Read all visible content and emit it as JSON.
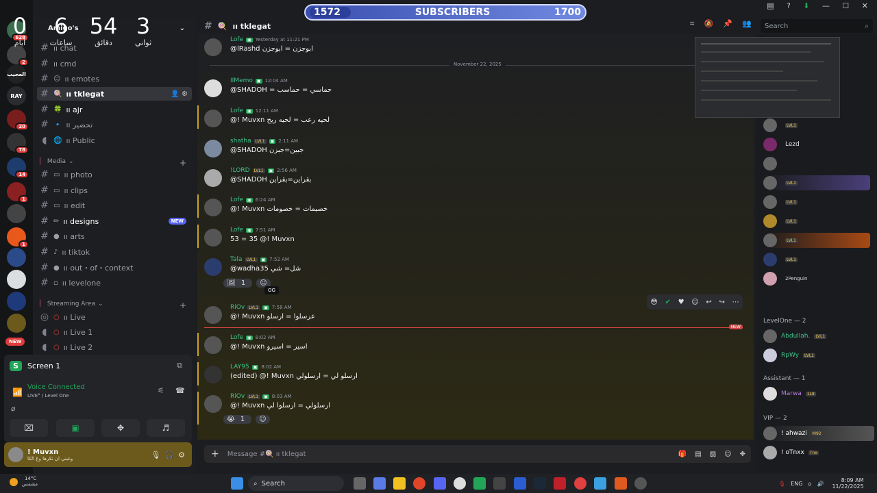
{
  "subscriber_bar": {
    "current": "1572",
    "label": "SUBSCRIBERS",
    "goal": "1700"
  },
  "countdown": [
    {
      "value": "0",
      "label": "أيام"
    },
    {
      "value": "6",
      "label": "ساعات"
    },
    {
      "value": "54",
      "label": "دقائق"
    },
    {
      "value": "3",
      "label": "ثواني"
    }
  ],
  "server": {
    "name": "Amigo's"
  },
  "server_rail": [
    {
      "label": "",
      "badge": "628"
    },
    {
      "label": "",
      "badge": "2"
    },
    {
      "label": "العجيب",
      "badge": ""
    },
    {
      "label": "RAY",
      "badge": ""
    },
    {
      "label": "",
      "badge": "20"
    },
    {
      "label": "",
      "badge": "78"
    },
    {
      "label": "",
      "badge": "14"
    },
    {
      "label": "",
      "badge": "1"
    },
    {
      "label": "",
      "badge": ""
    },
    {
      "label": "",
      "badge": "1"
    },
    {
      "label": "",
      "badge": ""
    },
    {
      "label": "",
      "badge": ""
    },
    {
      "label": "",
      "badge": ""
    },
    {
      "label": "",
      "badge": ""
    }
  ],
  "server_new": "NEW",
  "channels": {
    "top": [
      {
        "name": "ıı chat",
        "emoji": ""
      },
      {
        "name": "ıı cmd",
        "emoji": ""
      },
      {
        "name": "ıı emotes",
        "emoji": ""
      },
      {
        "name": "ıı tklegat",
        "emoji": "🍭",
        "active": true
      },
      {
        "name": "ıı ajr",
        "emoji": "🍀"
      },
      {
        "name": "ıı تحضير",
        "emoji": "🔹"
      },
      {
        "name": "ıı Public",
        "emoji": "🌐",
        "voice": true
      }
    ],
    "media_category": "Media",
    "media": [
      {
        "name": "ıı photo",
        "emoji": "▭"
      },
      {
        "name": "ıı clips",
        "emoji": "▭"
      },
      {
        "name": "ıı edit",
        "emoji": "▭"
      },
      {
        "name": "ıı designs",
        "emoji": "✏",
        "new": "NEW"
      },
      {
        "name": "ıı arts",
        "emoji": "●"
      },
      {
        "name": "ıı tiktok",
        "emoji": "♪"
      },
      {
        "name": "ıı out・of・context",
        "emoji": "●"
      },
      {
        "name": "ıı levelone",
        "emoji": "▫"
      }
    ],
    "streaming_category": "Streaming Area",
    "streaming": [
      {
        "name": "ıı Live"
      },
      {
        "name": "ıı Live 1"
      },
      {
        "name": "ıı Live 2"
      }
    ]
  },
  "screen_share": {
    "label": "Screen 1"
  },
  "voice": {
    "status": "Voice Connected",
    "detail": "LIVE° / Level One"
  },
  "user": {
    "name": "! Muvxn",
    "status": "وغبني ان تكرها وغ الكا"
  },
  "chat": {
    "channel": "ıı tklegat",
    "date_divider": "November 22, 2025",
    "new_label": "NEW",
    "tooltip": "OG",
    "messages": [
      {
        "name": "Lofe",
        "time": "Yesterday at 11:21 PM",
        "body": "@lRashd ابوجزن = ابوجزن",
        "color": "#3ec48a"
      },
      {
        "name": "IIMemo",
        "time": "12:04 AM",
        "body": "@SHADOH = حماسي = حماسب",
        "color": "#3ec48a"
      },
      {
        "name": "Lofe",
        "time": "12:11 AM",
        "body": "@! Muvxn لحيه رعب = لحيه ريح",
        "color": "#3ec48a"
      },
      {
        "name": "shatha",
        "time": "2:11 AM",
        "body": "@SHADOH جبين=جبزن",
        "color": "#3ec48a",
        "lvl": "LVL1"
      },
      {
        "name": "!LORD",
        "time": "2:56 AM",
        "body": "@SHADOH بقراين=بقراين",
        "color": "#3ec48a",
        "lvl": "LVL1"
      },
      {
        "name": "Lofe",
        "time": "6:24 AM",
        "body": "@! Muvxn خصيمات = خصومات",
        "color": "#3ec48a"
      },
      {
        "name": "Lofe",
        "time": "7:51 AM",
        "body": "53 = 35 @! Muvxn",
        "color": "#3ec48a"
      },
      {
        "name": "Tala",
        "time": "7:52 AM",
        "body": "@wadha35 شل= شي",
        "color": "#3ec48a",
        "lvl": "LVL1",
        "reaction": "1"
      },
      {
        "name": "RiOv",
        "time": "7:58 AM",
        "body": "@! Muvxn عرسلوا = ارسلو",
        "color": "#3ec48a",
        "lvl": "LVL1"
      },
      {
        "name": "Lofe",
        "time": "8:02 AM",
        "body": "@! Muvxn اسير = اسيرو",
        "color": "#3ec48a"
      },
      {
        "name": "LAY95",
        "time": "8:02 AM",
        "body": "(edited) @! Muvxn ارسلو لي = ارسلولي",
        "color": "#3ec48a"
      },
      {
        "name": "RiOv",
        "time": "8:03 AM",
        "body": "@! Muvxn ارسلولي = ارسلوا لي",
        "color": "#3ec48a",
        "lvl": "LVL1",
        "reaction": "1"
      }
    ],
    "composer_placeholder": "Message #🍭 ıı tklegat"
  },
  "search": {
    "placeholder": "Search"
  },
  "members": {
    "list_top": [
      {
        "name": "",
        "role": "LVL1"
      },
      {
        "name": "",
        "role": "Lezd"
      },
      {
        "name": "",
        "role": ""
      },
      {
        "name": "",
        "role": "LVL1"
      },
      {
        "name": "",
        "role": "LVL1"
      },
      {
        "name": "",
        "role": "LVL1"
      },
      {
        "name": "",
        "role": "LVL1"
      },
      {
        "name": "",
        "role": "LVL1"
      },
      {
        "name": "",
        "role": "2Penguin"
      }
    ],
    "group_levelone": "LevelOne — 2",
    "levelone": [
      {
        "name": "Abdullah.",
        "role": "LVL1"
      },
      {
        "name": "RpWy",
        "role": "LVL1",
        "sub": "Pero"
      }
    ],
    "group_assistant": "Assistant — 1",
    "assistant": [
      {
        "name": "Marwa",
        "role": "1L8"
      }
    ],
    "group_vip": "VIP — 2",
    "vip": [
      {
        "name": "! ahwazi",
        "role": "M92"
      },
      {
        "name": "! oTnxx",
        "role": "Tnx",
        "sub": "oTnxx"
      }
    ]
  },
  "taskbar": {
    "search": "Search",
    "weather_temp": "14°C",
    "weather_desc": "مشمس",
    "lang": "ENG",
    "time": "8:09 AM",
    "date": "11/22/2025"
  },
  "colors": {
    "accent": "#5865f2",
    "online": "#23a559",
    "mention_bar": "#c9a227",
    "new_line": "#d64545"
  }
}
